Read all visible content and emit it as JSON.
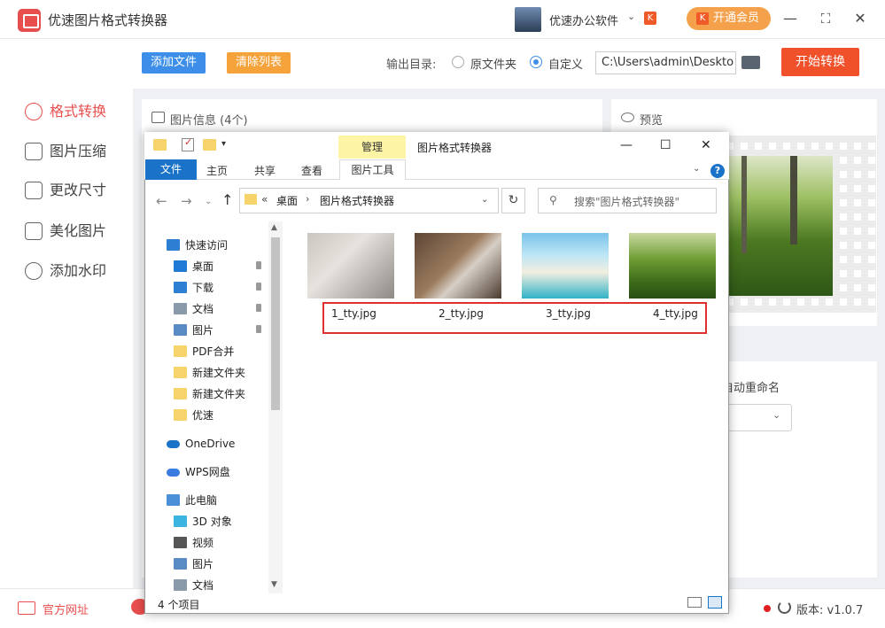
{
  "app": {
    "title": "优速图片格式转换器",
    "user_name": "优速办公软件",
    "vip_label": "开通会员"
  },
  "sidebar": {
    "items": [
      {
        "label": "格式转换",
        "icon": "convert-icon",
        "active": true
      },
      {
        "label": "图片压缩",
        "icon": "compress-icon"
      },
      {
        "label": "更改尺寸",
        "icon": "resize-icon"
      },
      {
        "label": "美化图片",
        "icon": "beautify-icon"
      },
      {
        "label": "添加水印",
        "icon": "watermark-icon"
      }
    ]
  },
  "toolbar": {
    "add_file": "添加文件",
    "clear_list": "清除列表",
    "output_label": "输出目录:",
    "radio_original": "原文件夹",
    "radio_custom": "自定义",
    "output_path": "C:\\Users\\admin\\Deskto",
    "start_button": "开始转换"
  },
  "panels": {
    "info_title": "图片信息 (4个)",
    "preview_title": "预览",
    "rename_label": "自动重命名"
  },
  "bottom": {
    "site_link": "官方网址",
    "version": "版本: v1.0.7"
  },
  "explorer": {
    "title": "图片格式转换器",
    "manage_tab": "管理",
    "tabs": [
      "文件",
      "主页",
      "共享",
      "查看"
    ],
    "tools_tab": "图片工具",
    "address_desktop": "桌面",
    "address_current": "图片格式转换器",
    "address_prefix": "«",
    "search_placeholder": "搜索\"图片格式转换器\"",
    "nav_items": [
      {
        "label": "快速访问",
        "icon": "star-icon",
        "level": 0
      },
      {
        "label": "桌面",
        "icon": "desktop-icon",
        "level": 1,
        "pinned": true
      },
      {
        "label": "下载",
        "icon": "download-icon",
        "level": 1,
        "pinned": true
      },
      {
        "label": "文档",
        "icon": "document-icon",
        "level": 1,
        "pinned": true
      },
      {
        "label": "图片",
        "icon": "pictures-icon",
        "level": 1,
        "pinned": true
      },
      {
        "label": "PDF合并",
        "icon": "folder-icon",
        "level": 1
      },
      {
        "label": "新建文件夹",
        "icon": "folder-icon",
        "level": 1
      },
      {
        "label": "新建文件夹",
        "icon": "folder-icon",
        "level": 1
      },
      {
        "label": "优速",
        "icon": "folder-icon",
        "level": 1
      },
      {
        "label": "OneDrive",
        "icon": "onedrive-icon",
        "level": 0
      },
      {
        "label": "WPS网盘",
        "icon": "wps-cloud-icon",
        "level": 0
      },
      {
        "label": "此电脑",
        "icon": "computer-icon",
        "level": 0
      },
      {
        "label": "3D 对象",
        "icon": "3d-objects-icon",
        "level": 1
      },
      {
        "label": "视频",
        "icon": "video-icon",
        "level": 1
      },
      {
        "label": "图片",
        "icon": "pictures-icon",
        "level": 1
      },
      {
        "label": "文档",
        "icon": "document-icon",
        "level": 1
      }
    ],
    "files": [
      "1_tty.jpg",
      "2_tty.jpg",
      "3_tty.jpg",
      "4_tty.jpg"
    ],
    "item_count": "4 个项目"
  },
  "colors": {
    "accent_red": "#e94e4e",
    "primary_blue": "#3c8ee8",
    "orange": "#f5a23a",
    "start_red": "#f0502a",
    "highlight": "#e02f2f"
  }
}
